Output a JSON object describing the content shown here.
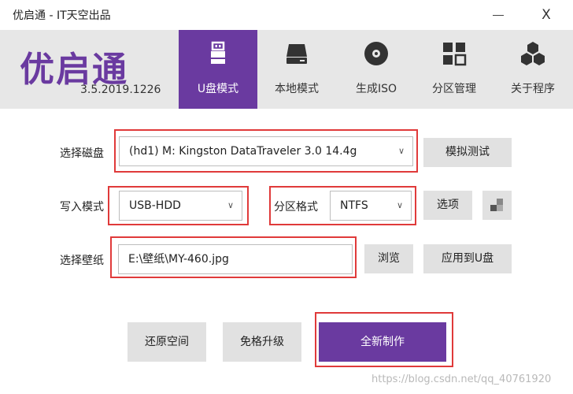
{
  "window": {
    "title": "优启通 - IT天空出品",
    "minimize_icon": "minimize-icon",
    "close_label": "X"
  },
  "header": {
    "logo": "优启通",
    "version": "3.5.2019.1226"
  },
  "tabs": [
    {
      "label": "U盘模式",
      "icon": "usb-drive-icon",
      "active": true
    },
    {
      "label": "本地模式",
      "icon": "hard-drive-icon",
      "active": false
    },
    {
      "label": "生成ISO",
      "icon": "disc-icon",
      "active": false
    },
    {
      "label": "分区管理",
      "icon": "partition-grid-icon",
      "active": false
    },
    {
      "label": "关于程序",
      "icon": "hexagon-cluster-icon",
      "active": false
    }
  ],
  "form": {
    "disk_label": "选择磁盘",
    "disk_value": "(hd1) M: Kingston DataTraveler 3.0 14.4g",
    "simulate_button": "模拟测试",
    "write_mode_label": "写入模式",
    "write_mode_value": "USB-HDD",
    "partition_format_label": "分区格式",
    "partition_format_value": "NTFS",
    "options_button": "选项",
    "wallpaper_label": "选择壁纸",
    "wallpaper_value": "E:\\壁纸\\MY-460.jpg",
    "browse_button": "浏览",
    "apply_button": "应用到U盘"
  },
  "actions": {
    "restore_button": "还原空间",
    "upgrade_button": "免格升级",
    "create_button": "全新制作"
  },
  "colors": {
    "accent": "#6a3aa0",
    "highlight_border": "#e03a3a",
    "banner_bg": "#e7e7e7"
  },
  "watermark": "https://blog.csdn.net/qq_40761920"
}
